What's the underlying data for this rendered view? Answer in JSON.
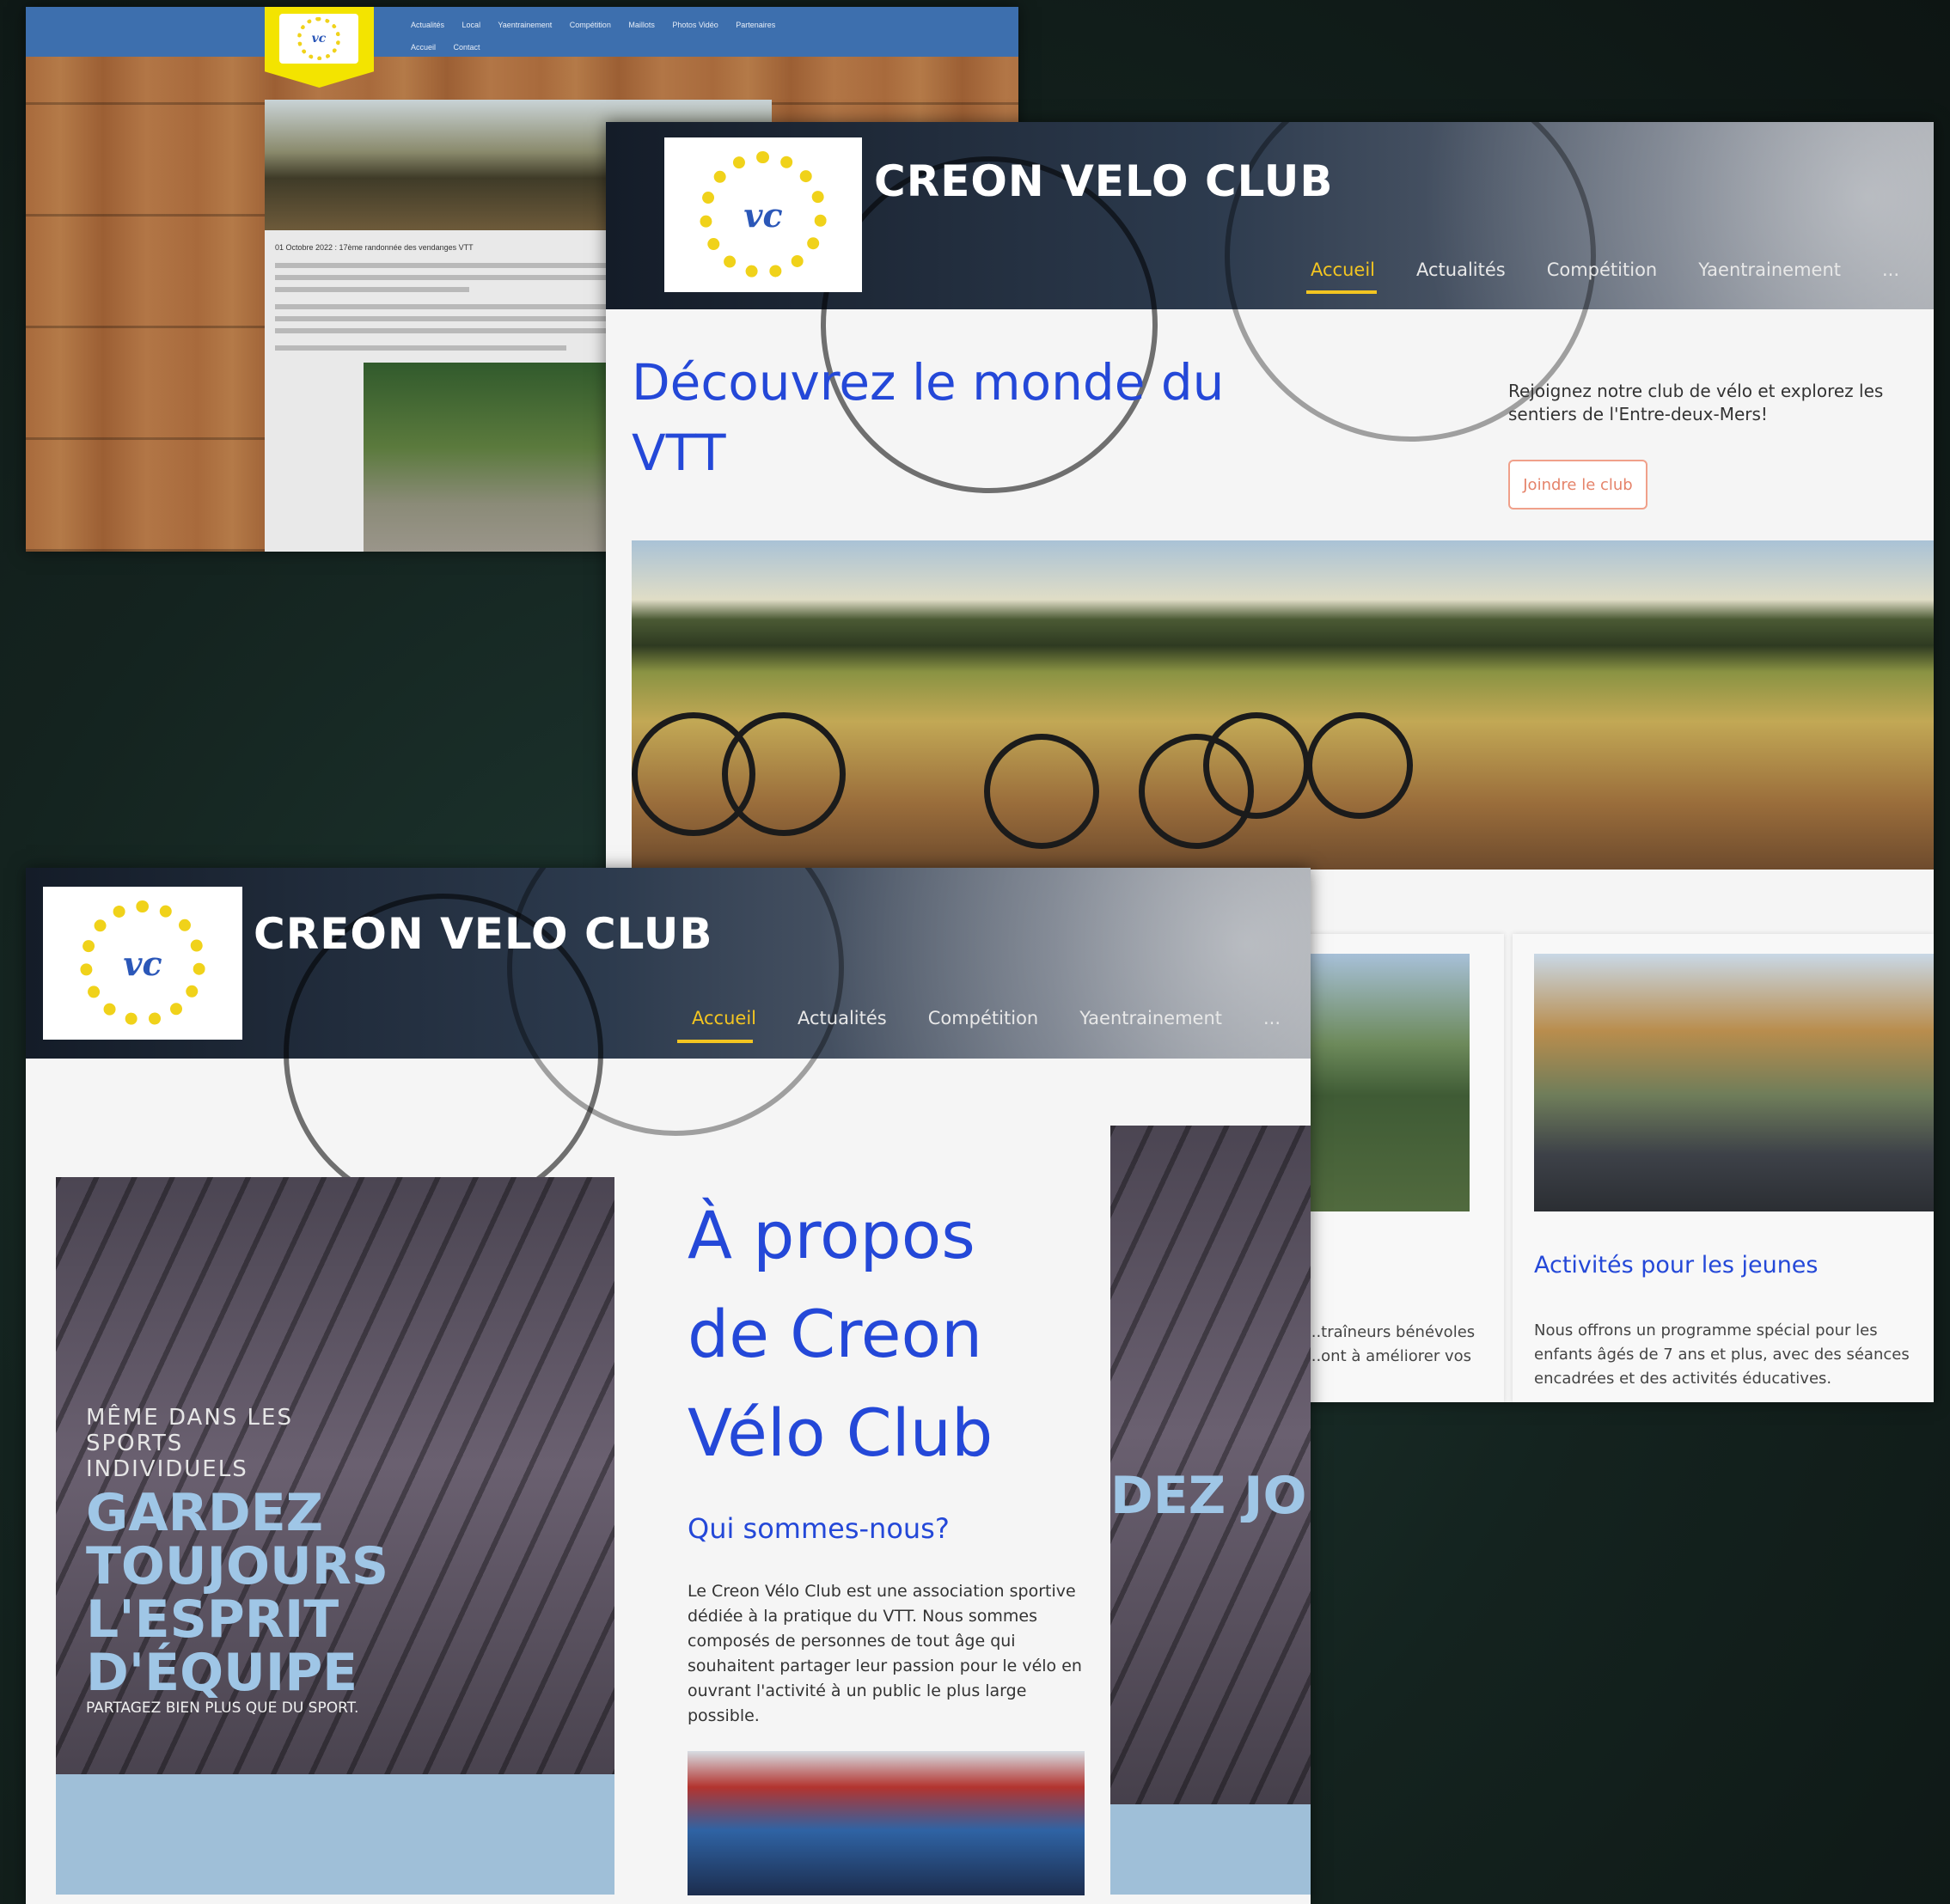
{
  "old_site": {
    "nav_row1": [
      "Actualités",
      "Local",
      "Yaentrainement",
      "Compétition",
      "Maillots",
      "Photos Vidéo",
      "Partenaires"
    ],
    "nav_row2": [
      "Accueil",
      "Contact"
    ],
    "post_title": "01 Octobre 2022 : 17ème randonnée des vendanges VTT"
  },
  "site": {
    "brand": "CREON VELO CLUB",
    "menu": [
      "Accueil",
      "Actualités",
      "Compétition",
      "Yaentrainement",
      "..."
    ],
    "colors": {
      "accent_blue": "#2448d8",
      "accent_yellow": "#f3c521",
      "button_border": "#f0a08a"
    }
  },
  "home": {
    "hero_title": "Découvrez le monde du VTT",
    "hero_sub": "Rejoignez notre club de vélo et explorez les sentiers de l'Entre-deux-Mers!",
    "join_button": "Joindre le club",
    "card1_text": "...traîneurs bénévoles ...ont à améliorer vos",
    "card2_title": "Activités pour les jeunes",
    "card2_text": "Nous offrons un programme spécial pour les enfants âgés de 7 ans et plus, avec des séances encadrées et des activités éducatives."
  },
  "about": {
    "title": "À propos de Creon Vélo Club",
    "subtitle": "Qui sommes-nous?",
    "text": "Le Creon Vélo Club est une association sportive dédiée à la pratique du VTT. Nous sommes composés de personnes de tout âge qui souhaitent partager leur passion pour le vélo en ouvrant l'activité à un public le plus large possible.",
    "poster_small": "MÊME DANS LES SPORTS INDIVIDUELS",
    "poster_big": "GARDEZ TOUJOURS L'ESPRIT D'ÉQUIPE",
    "poster_strap": "PARTAGEZ BIEN PLUS QUE DU SPORT.",
    "poster2_big": "DEZ JOURS RIT UIPE"
  }
}
